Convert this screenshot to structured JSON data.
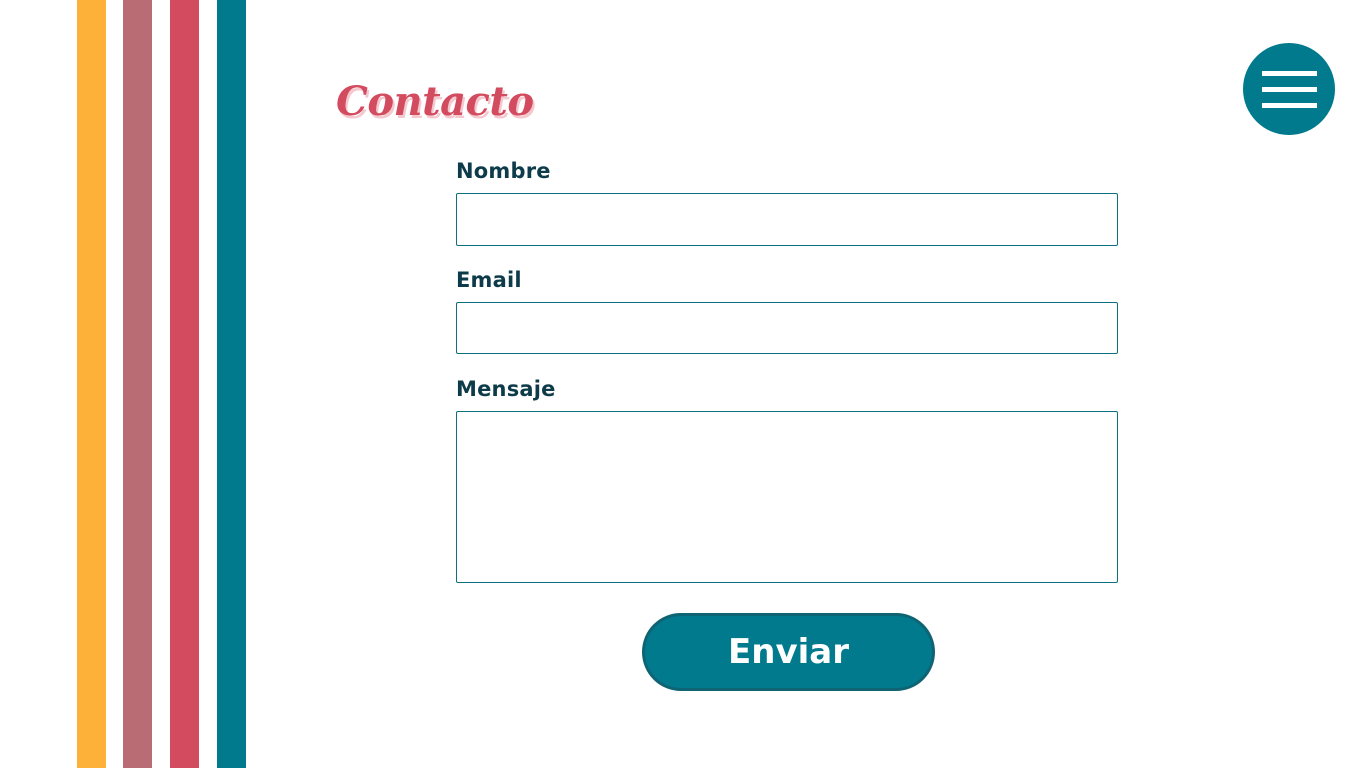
{
  "colors": {
    "stripe_yellow": "#FDB139",
    "stripe_mauve": "#B96C73",
    "stripe_red": "#D34B5E",
    "stripe_teal": "#007A8C",
    "title": "#D34B5E",
    "title_shadow": "#F5C7CF",
    "label": "#0E3B4A",
    "field_border": "#0E6F7F",
    "accent": "#007A8C",
    "button_border": "#0E6473"
  },
  "header": {
    "title": "Contacto",
    "menu_icon": "hamburger-menu-icon"
  },
  "form": {
    "name_label": "Nombre",
    "name_value": "",
    "email_label": "Email",
    "email_value": "",
    "message_label": "Mensaje",
    "message_value": "",
    "submit_label": "Enviar"
  }
}
